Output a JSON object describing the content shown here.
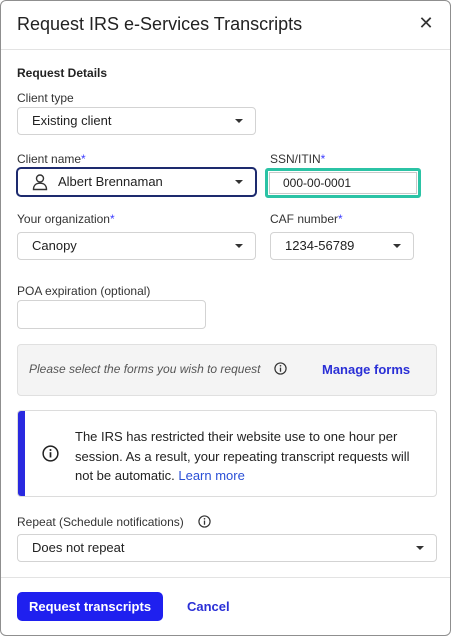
{
  "dialog": {
    "title": "Request IRS e-Services Transcripts",
    "close_icon": "close-icon",
    "section_title": "Request Details"
  },
  "client_type": {
    "label": "Client type",
    "value": "Existing client"
  },
  "client_name": {
    "label": "Client name",
    "required": "*",
    "value": "Albert Brennaman",
    "icon": "person-icon"
  },
  "ssn": {
    "label": "SSN/ITIN",
    "required": "*",
    "value": "000-00-0001"
  },
  "organization": {
    "label": "Your organization",
    "required": "*",
    "value": "Canopy"
  },
  "caf": {
    "label": "CAF number",
    "required": "*",
    "value": "1234-56789"
  },
  "poa": {
    "label": "POA expiration (optional)",
    "value": ""
  },
  "forms": {
    "prompt": "Please select the forms you wish to request",
    "manage_label": "Manage forms",
    "icon": "info-icon"
  },
  "notice": {
    "text": "The IRS has restricted their website use to one hour per session. As a result, your repeating transcript requests will not be automatic.",
    "link": "Learn more",
    "icon": "info-icon"
  },
  "repeat": {
    "label": "Repeat (Schedule notifications)",
    "value": "Does not repeat"
  },
  "footer": {
    "submit_label": "Request transcripts",
    "cancel_label": "Cancel"
  },
  "colors": {
    "primary": "#1f20ef",
    "link": "#2a2fd6",
    "highlight": "#2bc3a5",
    "notice_bar": "#2929e0"
  }
}
